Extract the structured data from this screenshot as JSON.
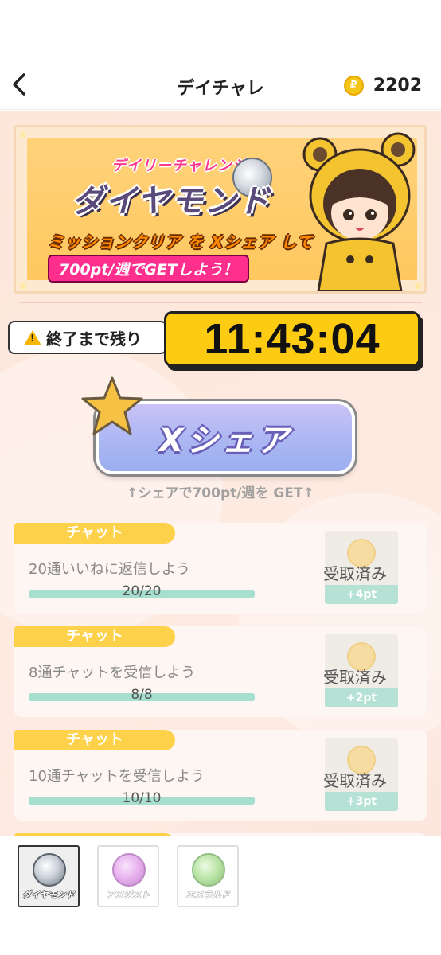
{
  "header": {
    "title": "デイチャレ",
    "coin_symbol": "₽",
    "coin_value": "2202"
  },
  "banner": {
    "subtitle": "デイリーチャレンジ",
    "title": "ダイヤモンド",
    "line1": "ミッションクリア を Xシェア して",
    "line2": "700pt/週でGETしよう！"
  },
  "timer": {
    "label": "終了まで残り",
    "value": "11:43:04"
  },
  "share": {
    "button_label": "Xシェア",
    "hint": "↑シェアで700pt/週を GET↑"
  },
  "missions": [
    {
      "tag": "チャット",
      "text": "20通いいねに返信しよう",
      "count": "20/20",
      "progress": 1.0,
      "status": "受取済み",
      "reward": "+4pt"
    },
    {
      "tag": "チャット",
      "text": "8通チャットを受信しよう",
      "count": "8/8",
      "progress": 1.0,
      "status": "受取済み",
      "reward": "+2pt"
    },
    {
      "tag": "チャット",
      "text": "10通チャットを受信しよう",
      "count": "10/10",
      "progress": 1.0,
      "status": "受取済み",
      "reward": "+3pt"
    }
  ],
  "gem_tabs": [
    {
      "name": "ダイヤモンド",
      "color": "#c9d0d8",
      "active": true
    },
    {
      "name": "アメジスト",
      "color": "#d46fe0",
      "active": false
    },
    {
      "name": "エメラルド",
      "color": "#7fce5a",
      "active": false
    }
  ],
  "colors": {
    "accent_yellow": "#fecb13",
    "tag_yellow": "#fdd24a",
    "progress_green": "#a6dfcf",
    "share_purple": "#a9b6f2"
  }
}
